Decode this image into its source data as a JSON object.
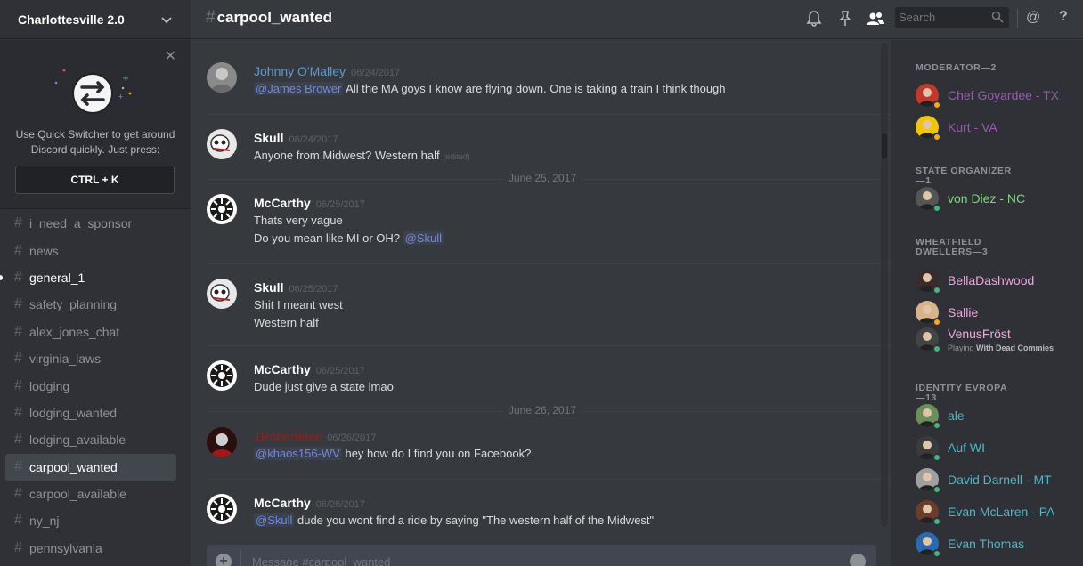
{
  "server": {
    "name": "Charlottesville 2.0"
  },
  "quick_switcher": {
    "text": "Use Quick Switcher to get around Discord quickly. Just press:",
    "shortcut": "CTRL + K"
  },
  "channels": [
    {
      "name": "i_need_a_sponsor",
      "state": "normal"
    },
    {
      "name": "news",
      "state": "normal"
    },
    {
      "name": "general_1",
      "state": "unread"
    },
    {
      "name": "safety_planning",
      "state": "normal"
    },
    {
      "name": "alex_jones_chat",
      "state": "normal"
    },
    {
      "name": "virginia_laws",
      "state": "normal"
    },
    {
      "name": "lodging",
      "state": "normal"
    },
    {
      "name": "lodging_wanted",
      "state": "normal"
    },
    {
      "name": "lodging_available",
      "state": "normal"
    },
    {
      "name": "carpool_wanted",
      "state": "active"
    },
    {
      "name": "carpool_available",
      "state": "normal"
    },
    {
      "name": "ny_nj",
      "state": "normal"
    },
    {
      "name": "pennsylvania",
      "state": "normal"
    }
  ],
  "header": {
    "hash": "#",
    "channel": "carpool_wanted",
    "search_placeholder": "Search",
    "at_icon": "@",
    "help_icon": "?"
  },
  "messages": [
    {
      "author": "Johnny O'Malley",
      "time": "06/24/2017",
      "color": "#5b9bd5",
      "lines": [
        {
          "mention": "@James Brower",
          "text": " All the MA goys I know are flying down. One is taking a train I think though"
        }
      ]
    },
    {
      "author": "Skull",
      "time": "06/24/2017",
      "color": "#ffffff",
      "lines": [
        {
          "text": "Anyone from Midwest? Western half",
          "edited": "(edited)"
        }
      ]
    },
    {
      "author": "McCarthy",
      "time": "06/25/2017",
      "color": "#ffffff",
      "lines": [
        {
          "text": "Thats very vague"
        },
        {
          "text": "Do you mean like MI or OH? ",
          "mention_after": "@Skull"
        }
      ]
    },
    {
      "author": "Skull",
      "time": "06/25/2017",
      "color": "#ffffff",
      "lines": [
        {
          "text": "Shit I meant west"
        },
        {
          "text": "Western half"
        }
      ]
    },
    {
      "author": "McCarthy",
      "time": "06/25/2017",
      "color": "#ffffff",
      "lines": [
        {
          "text": "Dude just give a state lmao"
        }
      ]
    },
    {
      "author": "1Robertelee",
      "time": "06/26/2017",
      "color": "#8b2323",
      "lines": [
        {
          "mention": "@khaos156-WV",
          "text": " hey how do I find you on Facebook?"
        }
      ]
    },
    {
      "author": "McCarthy",
      "time": "06/26/2017",
      "color": "#ffffff",
      "lines": [
        {
          "mention": "@Skull",
          "text": " dude you wont find a ride by saying \"The western half of the Midwest\""
        }
      ]
    }
  ],
  "day_separators": [
    "June 25, 2017",
    "June 26, 2017"
  ],
  "composer": {
    "placeholder": "Message #carpool_wanted"
  },
  "member_groups": [
    {
      "title": "MODERATOR—2",
      "members": [
        {
          "name": "Chef Goyardee - TX",
          "color": "#9b59b6",
          "status": "idle"
        },
        {
          "name": "Kurt - VA",
          "color": "#9b59b6",
          "status": "idle"
        }
      ]
    },
    {
      "title": "STATE ORGANIZER—1",
      "members": [
        {
          "name": "von Diez - NC",
          "color": "#7ed67b",
          "status": "online"
        }
      ]
    },
    {
      "title": "WHEATFIELD DWELLERS—3",
      "members": [
        {
          "name": "BellaDashwood",
          "color": "#f0a6e0",
          "status": "online"
        },
        {
          "name": "Sallie",
          "color": "#f0a6e0",
          "status": "idle"
        },
        {
          "name": "VenusFröst",
          "color": "#f0a6e0",
          "status": "online",
          "playing_prefix": "Playing ",
          "playing_game": "With Dead Commies"
        }
      ]
    },
    {
      "title": "IDENTITY EVROPA—13",
      "members": [
        {
          "name": "ale",
          "color": "#4ab8c8",
          "status": "online"
        },
        {
          "name": "Auf WI",
          "color": "#4ab8c8",
          "status": "online"
        },
        {
          "name": "David Darnell - MT",
          "color": "#4ab8c8",
          "status": "online"
        },
        {
          "name": "Evan McLaren - PA",
          "color": "#4ab8c8",
          "status": "online"
        },
        {
          "name": "Evan Thomas",
          "color": "#4ab8c8",
          "status": "online"
        }
      ]
    }
  ]
}
